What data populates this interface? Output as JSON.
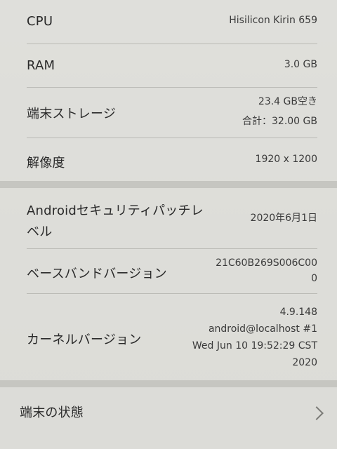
{
  "rows": {
    "cpu": {
      "label": "CPU",
      "value": "Hisilicon Kirin 659"
    },
    "ram": {
      "label": "RAM",
      "value": "3.0 GB"
    },
    "storage": {
      "label": "端末ストレージ",
      "value_line1": "23.4  GB空き",
      "value_line2": "合計：32.00  GB"
    },
    "resolution": {
      "label": "解像度",
      "value": "1920 x 1200"
    },
    "security_patch": {
      "label_line1": "Androidセキュリティパッチレ",
      "label_line2": "ベル",
      "value": "2020年6月1日"
    },
    "baseband": {
      "label": "ベースバンドバージョン",
      "value_line1": "21C60B269S006C00",
      "value_line2": "0"
    },
    "kernel": {
      "label": "カーネルバージョン",
      "value_line1": "4.9.148",
      "value_line2": "android@localhost #1",
      "value_line3": "Wed Jun 10 19:52:29 CST",
      "value_line4": "2020"
    },
    "device_status": {
      "label": "端末の状態",
      "icon": "chevron-right-icon"
    }
  }
}
